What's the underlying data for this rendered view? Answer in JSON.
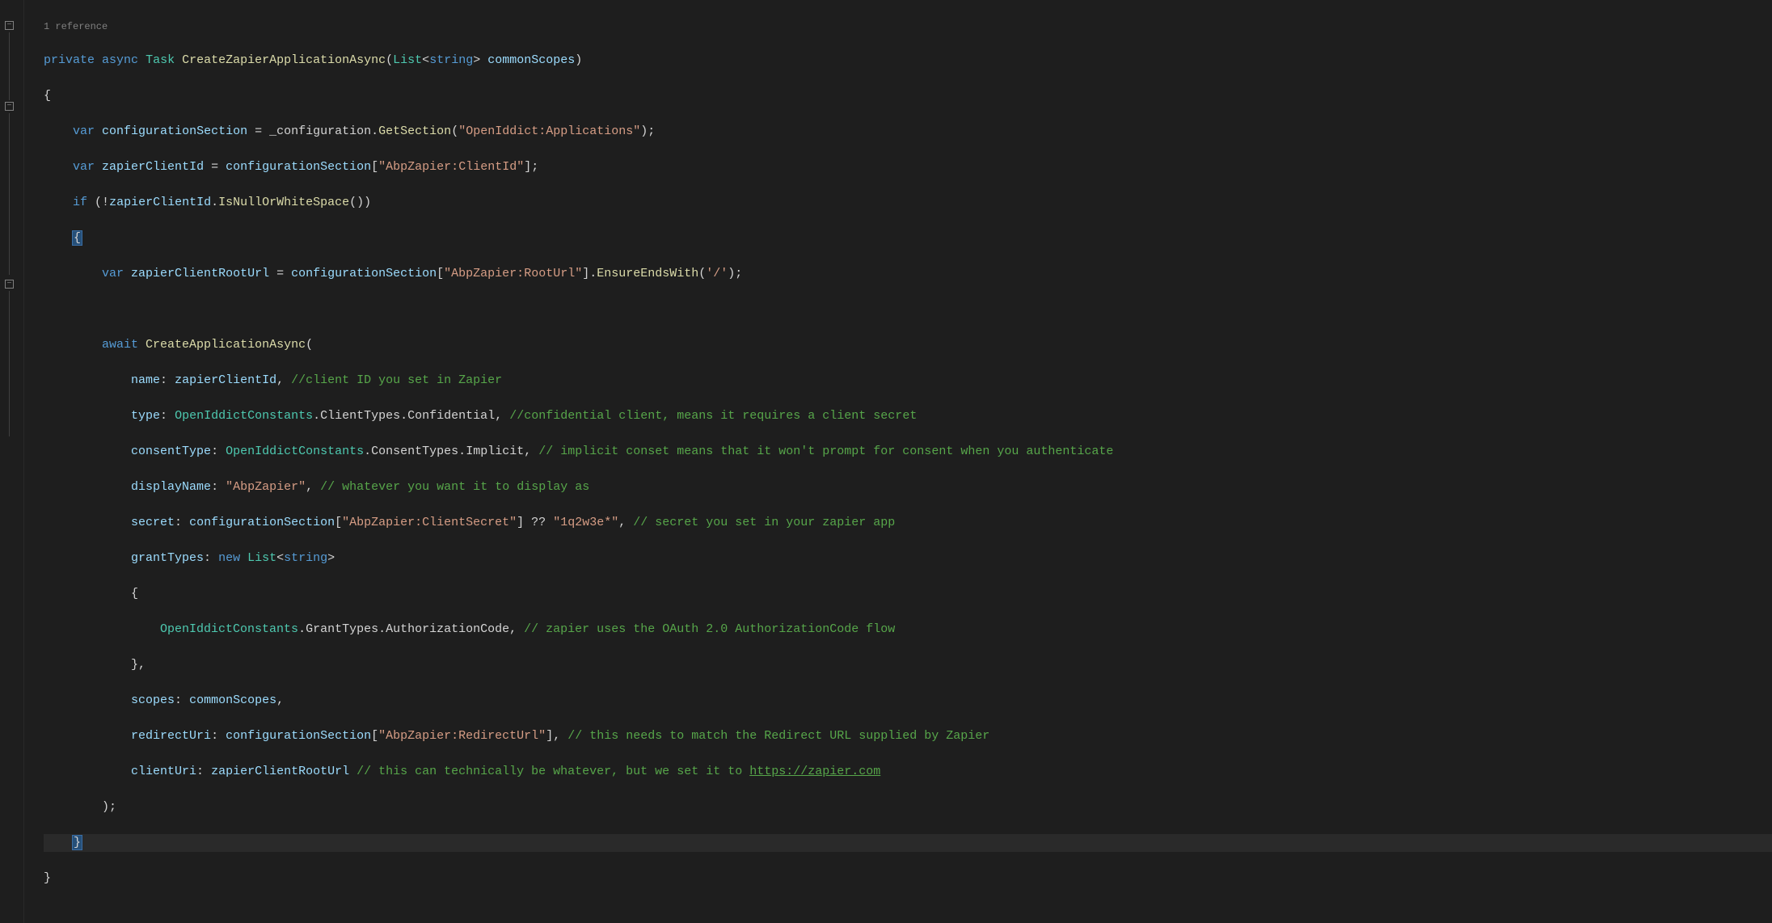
{
  "codelens": {
    "references": "1 reference"
  },
  "fold": {
    "minus": "−"
  },
  "code": {
    "kw_private": "private",
    "kw_async": "async",
    "ty_Task": "Task",
    "m_CreateZapierApplicationAsync": "CreateZapierApplicationAsync",
    "ty_List": "List",
    "ty_string": "string",
    "p_commonScopes": "commonScopes",
    "kw_var": "var",
    "v_configurationSection": "configurationSection",
    "f_configuration": "_configuration",
    "m_GetSection": "GetSection",
    "s_openiddict_apps": "\"OpenIddict:Applications\"",
    "v_zapierClientId": "zapierClientId",
    "s_abpzapier_clientid": "\"AbpZapier:ClientId\"",
    "kw_if": "if",
    "m_IsNullOrWhiteSpace": "IsNullOrWhiteSpace",
    "v_zapierClientRootUrl": "zapierClientRootUrl",
    "s_abpzapier_rooturl": "\"AbpZapier:RootUrl\"",
    "m_EnsureEndsWith": "EnsureEndsWith",
    "s_slash": "'/'",
    "kw_await": "await",
    "m_CreateApplicationAsync": "CreateApplicationAsync",
    "p_name": "name",
    "c_name": "//client ID you set in Zapier",
    "p_type": "type",
    "ty_OpenIddictConstants": "OpenIddictConstants",
    "prop_ClientTypes": "ClientTypes",
    "prop_Confidential": "Confidential",
    "c_type": "//confidential client, means it requires a client secret",
    "p_consentType": "consentType",
    "prop_ConsentTypes": "ConsentTypes",
    "prop_Implicit": "Implicit",
    "c_consent": "// implicit conset means that it won't prompt for consent when you authenticate",
    "p_displayName": "displayName",
    "s_AbpZapier": "\"AbpZapier\"",
    "c_display": "// whatever you want it to display as",
    "p_secret": "secret",
    "s_clientsecret": "\"AbpZapier:ClientSecret\"",
    "s_default_secret": "\"1q2w3e*\"",
    "c_secret": "// secret you set in your zapier app",
    "p_grantTypes": "grantTypes",
    "kw_new": "new",
    "prop_GrantTypes": "GrantTypes",
    "prop_AuthorizationCode": "AuthorizationCode",
    "c_grant": "// zapier uses the OAuth 2.0 AuthorizationCode flow",
    "p_scopes": "scopes",
    "p_redirectUri": "redirectUri",
    "s_redirecturl": "\"AbpZapier:RedirectUrl\"",
    "c_redirect": "// this needs to match the Redirect URL supplied by Zapier",
    "p_clientUri": "clientUri",
    "c_clienturi_pre": "// this can technically be whatever, but we set it to ",
    "c_clienturi_url": "https://zapier.com"
  }
}
